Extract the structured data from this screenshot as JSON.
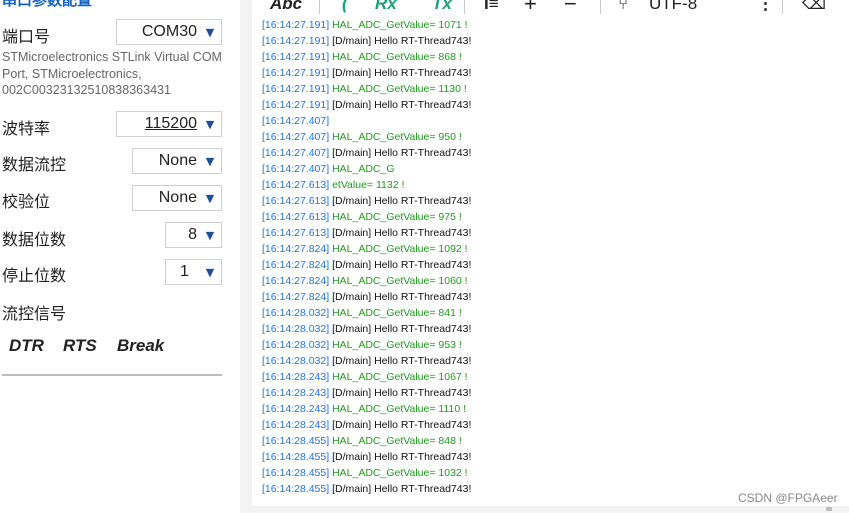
{
  "serial": {
    "section_title": "串口参数配置",
    "port_label": "端口号",
    "port_value": "COM30",
    "port_description": "STMicroelectronics STLink Virtual COM Port, STMicroelectronics, 002C00323132510838363431",
    "baud_label": "波特率",
    "baud_value": "115200",
    "flow_label": "数据流控",
    "flow_value": "None",
    "parity_label": "校验位",
    "parity_value": "None",
    "databits_label": "数据位数",
    "databits_value": "8",
    "stopbits_label": "停止位数",
    "stopbits_value": "1",
    "flow_signal_label": "流控信号",
    "dtr": "DTR",
    "rts": "RTS",
    "break": "Break"
  },
  "toolbar": {
    "abc": "Abc",
    "rx": "Rx",
    "tx": "Tx",
    "encoding": "UTF-8"
  },
  "log": [
    {
      "ts": "[16:14:27.191]",
      "msg": "HAL_ADC_GetValue= 1071 !",
      "kind": "rx"
    },
    {
      "ts": "[16:14:27.191]",
      "msg": "[D/main] Hello RT-Thread743!",
      "kind": "main"
    },
    {
      "ts": "[16:14:27.191]",
      "msg": "HAL_ADC_GetValue= 868 !",
      "kind": "rx"
    },
    {
      "ts": "[16:14:27.191]",
      "msg": "[D/main] Hello RT-Thread743!",
      "kind": "main"
    },
    {
      "ts": "[16:14:27.191]",
      "msg": "HAL_ADC_GetValue= 1130 !",
      "kind": "rx"
    },
    {
      "ts": "[16:14:27.191]",
      "msg": "[D/main] Hello RT-Thread743!",
      "kind": "main"
    },
    {
      "ts": "[16:14:27.407]",
      "msg": "",
      "kind": "rx"
    },
    {
      "ts": "[16:14:27.407]",
      "msg": "HAL_ADC_GetValue= 950 !",
      "kind": "rx"
    },
    {
      "ts": "[16:14:27.407]",
      "msg": "[D/main] Hello RT-Thread743!",
      "kind": "main"
    },
    {
      "ts": "[16:14:27.407]",
      "msg": "HAL_ADC_G",
      "kind": "rx"
    },
    {
      "ts": "[16:14:27.613]",
      "msg": "etValue= 1132 !",
      "kind": "rx"
    },
    {
      "ts": "[16:14:27.613]",
      "msg": "[D/main] Hello RT-Thread743!",
      "kind": "main"
    },
    {
      "ts": "[16:14:27.613]",
      "msg": "HAL_ADC_GetValue= 975 !",
      "kind": "rx"
    },
    {
      "ts": "[16:14:27.613]",
      "msg": "[D/main] Hello RT-Thread743!",
      "kind": "main"
    },
    {
      "ts": "[16:14:27.824]",
      "msg": "HAL_ADC_GetValue= 1092 !",
      "kind": "rx"
    },
    {
      "ts": "[16:14:27.824]",
      "msg": "[D/main] Hello RT-Thread743!",
      "kind": "main"
    },
    {
      "ts": "[16:14:27.824]",
      "msg": "HAL_ADC_GetValue= 1060 !",
      "kind": "rx"
    },
    {
      "ts": "[16:14:27.824]",
      "msg": "[D/main] Hello RT-Thread743!",
      "kind": "main"
    },
    {
      "ts": "[16:14:28.032]",
      "msg": "HAL_ADC_GetValue= 841 !",
      "kind": "rx"
    },
    {
      "ts": "[16:14:28.032]",
      "msg": "[D/main] Hello RT-Thread743!",
      "kind": "main"
    },
    {
      "ts": "[16:14:28.032]",
      "msg": "HAL_ADC_GetValue= 953 !",
      "kind": "rx"
    },
    {
      "ts": "[16:14:28.032]",
      "msg": "[D/main] Hello RT-Thread743!",
      "kind": "main"
    },
    {
      "ts": "[16:14:28.243]",
      "msg": "HAL_ADC_GetValue= 1067 !",
      "kind": "rx"
    },
    {
      "ts": "[16:14:28.243]",
      "msg": "[D/main] Hello RT-Thread743!",
      "kind": "main"
    },
    {
      "ts": "[16:14:28.243]",
      "msg": "HAL_ADC_GetValue= 1110 !",
      "kind": "rx"
    },
    {
      "ts": "[16:14:28.243]",
      "msg": "[D/main] Hello RT-Thread743!",
      "kind": "main"
    },
    {
      "ts": "[16:14:28.455]",
      "msg": "HAL_ADC_GetValue= 848 !",
      "kind": "rx"
    },
    {
      "ts": "[16:14:28.455]",
      "msg": "[D/main] Hello RT-Thread743!",
      "kind": "main"
    },
    {
      "ts": "[16:14:28.455]",
      "msg": "HAL_ADC_GetValue= 1032 !",
      "kind": "rx"
    },
    {
      "ts": "[16:14:28.455]",
      "msg": "[D/main] Hello RT-Thread743!",
      "kind": "main"
    }
  ],
  "watermark": "CSDN @FPGAeer",
  "colors": {
    "timestamp": "#1a73e8",
    "rx_message": "#1b9e1b",
    "section_title": "#1565c0",
    "dropdown_arrow": "#1e4f9c",
    "toolbar_accent": "#1aa37a"
  }
}
